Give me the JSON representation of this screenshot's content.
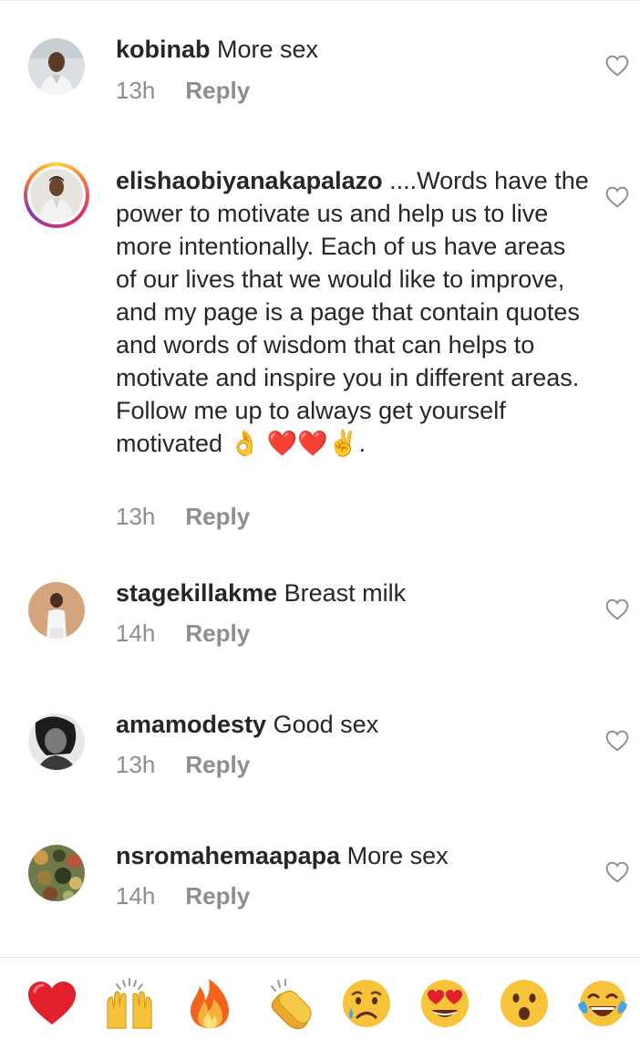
{
  "comments": [
    {
      "username": "kobinab",
      "text": " More sex",
      "time": "13h",
      "reply_label": "Reply"
    },
    {
      "username": "elishaobiyanakapalazo",
      "text": " ....Words have the power to motivate us and help us to live more intentionally. Each of us have areas of our lives that we would like to improve, and my page is a page that contain quotes and words of wisdom that can helps to motivate and inspire you in different areas.\nFollow me up to always get yourself motivated 👌 ❤️❤️✌️.",
      "time": "13h",
      "reply_label": "Reply"
    },
    {
      "username": "stagekillakme",
      "text": " Breast milk",
      "time": "14h",
      "reply_label": "Reply"
    },
    {
      "username": "amamodesty",
      "text": " Good sex",
      "time": "13h",
      "reply_label": "Reply"
    },
    {
      "username": "nsromahemaapapa",
      "text": " More sex",
      "time": "14h",
      "reply_label": "Reply"
    }
  ],
  "icons": {
    "like": "heart-outline-icon",
    "story_ring_colors": [
      "#fdd835",
      "#f77737",
      "#e1306c",
      "#833ab4"
    ]
  },
  "emoji_bar": [
    {
      "icon": "red-heart-emoji",
      "char": "❤️"
    },
    {
      "icon": "raising-hands-emoji",
      "char": "🙌"
    },
    {
      "icon": "fire-emoji",
      "char": "🔥"
    },
    {
      "icon": "clapping-hands-emoji",
      "char": "👏"
    },
    {
      "icon": "sad-face-emoji",
      "char": "😥"
    },
    {
      "icon": "heart-eyes-emoji",
      "char": "😍"
    },
    {
      "icon": "surprised-face-emoji",
      "char": "😮"
    },
    {
      "icon": "tears-of-joy-emoji",
      "char": "😂"
    }
  ]
}
